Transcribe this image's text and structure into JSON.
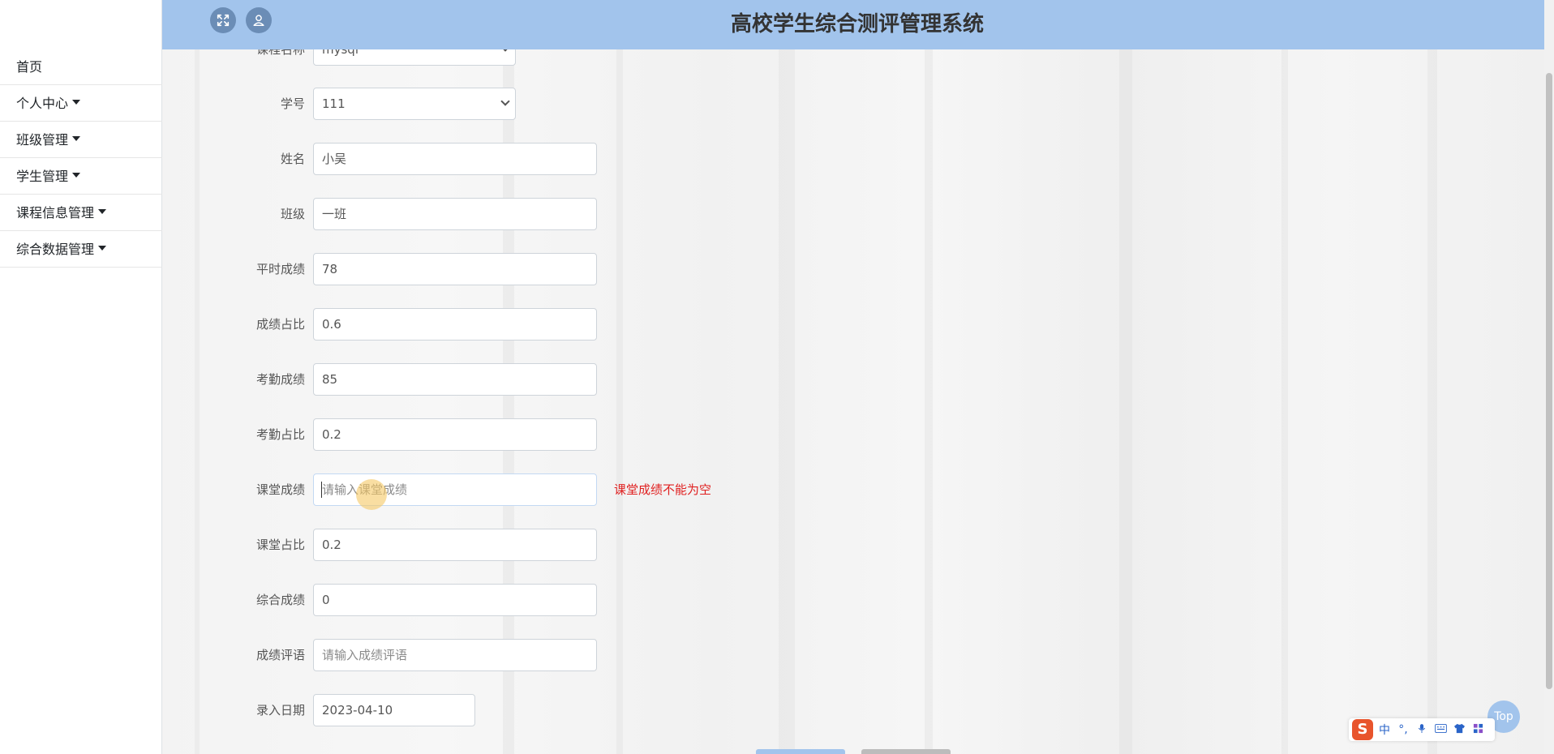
{
  "app": {
    "title": "高校学生综合测评管理系统"
  },
  "sidebar": {
    "items": [
      {
        "label": "首页",
        "has_caret": false
      },
      {
        "label": "个人中心",
        "has_caret": true
      },
      {
        "label": "班级管理",
        "has_caret": true
      },
      {
        "label": "学生管理",
        "has_caret": true
      },
      {
        "label": "课程信息管理",
        "has_caret": true
      },
      {
        "label": "综合数据管理",
        "has_caret": true
      }
    ]
  },
  "header": {
    "fullscreen_icon": "fullscreen-icon",
    "user_icon": "user-icon"
  },
  "form": {
    "course": {
      "label": "课程名称",
      "value": "mysql"
    },
    "student_no": {
      "label": "学号",
      "value": "111"
    },
    "name": {
      "label": "姓名",
      "value": "小吴"
    },
    "class": {
      "label": "班级",
      "value": "一班"
    },
    "usual_score": {
      "label": "平时成绩",
      "value": "78"
    },
    "score_ratio": {
      "label": "成绩占比",
      "value": "0.6"
    },
    "attendance_score": {
      "label": "考勤成绩",
      "value": "85"
    },
    "attendance_ratio": {
      "label": "考勤占比",
      "value": "0.2"
    },
    "class_score": {
      "label": "课堂成绩",
      "value": "",
      "placeholder": "请输入课堂成绩",
      "error": "课堂成绩不能为空"
    },
    "class_ratio": {
      "label": "课堂占比",
      "value": "0.2"
    },
    "total_score": {
      "label": "综合成绩",
      "value": "0"
    },
    "comment": {
      "label": "成绩评语",
      "value": "",
      "placeholder": "请输入成绩评语"
    },
    "entry_date": {
      "label": "录入日期",
      "value": "2023-04-10"
    }
  },
  "top_button": {
    "label": "Top"
  },
  "ime": {
    "logo": "S",
    "mode": "中",
    "punct": "°,",
    "icons": [
      "mic-icon",
      "keyboard-icon",
      "shirt-icon",
      "grid-icon"
    ]
  },
  "colors": {
    "header": "#a2c4ec",
    "error": "#e02020",
    "header_button": "#6b8db6"
  }
}
